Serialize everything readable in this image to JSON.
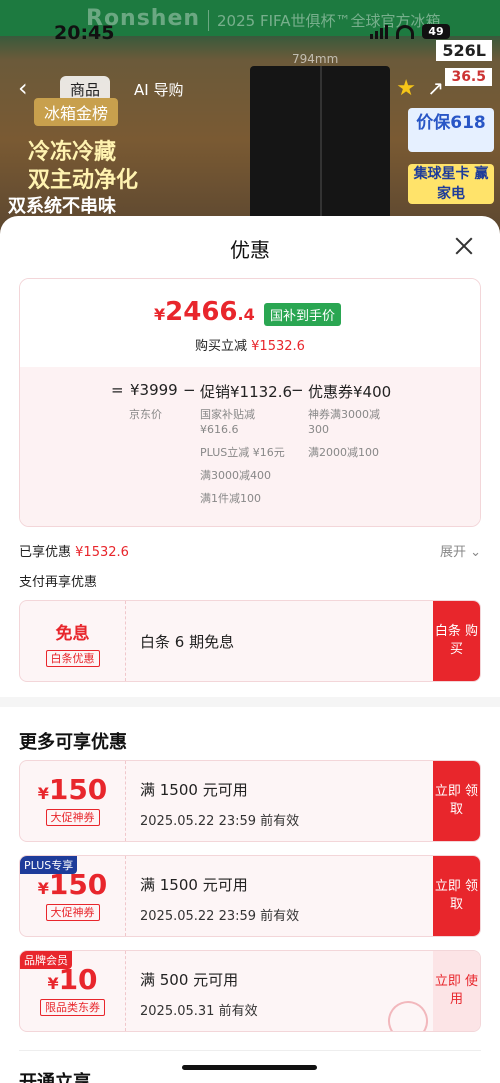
{
  "status_bar": {
    "time": "20:45",
    "battery": "49"
  },
  "background": {
    "brand": "Ronshen",
    "slogan": "2025 FIFA世俱杯™全球官方冰箱",
    "nav_tabs": [
      "商品",
      "AI 导购"
    ],
    "dimension": "794mm",
    "rank_title": "冰箱金榜",
    "slogan_lines": [
      "冷冻冷藏",
      "双主动净化",
      "双系统不串味"
    ],
    "capacity": "526L",
    "energy": "36.5",
    "promo": "价保618",
    "promo2": "集球星卡 赢家电"
  },
  "sheet": {
    "title": "优惠",
    "price": {
      "currency": "¥",
      "integer": "2466",
      "decimal": ".4",
      "tag": "国补到手价",
      "save_label": "购买立减",
      "save_value": "¥1532.6"
    },
    "formula": {
      "eq": "=",
      "base": "¥3999",
      "minus1": "−",
      "promo": "促销¥1132.6",
      "minus2": "−",
      "coupon": "优惠券¥400",
      "base_label": "京东价",
      "promo_details": [
        "国家补贴减 ¥616.6",
        "PLUS立减 ¥16元",
        "满3000减400",
        "满1件减100"
      ],
      "coupon_details": [
        "神券满3000减 300",
        "满2000减100"
      ]
    },
    "enjoyed": {
      "label": "已享优惠",
      "value": "¥1532.6",
      "expand": "展开"
    },
    "pay_title": "支付再享优惠",
    "pay_coupon": {
      "title": "免息",
      "tag": "白条优惠",
      "desc": "白条 6 期免息",
      "button": "白条 购买"
    },
    "more_title": "更多可享优惠",
    "coupons": [
      {
        "corner": "",
        "currency": "¥",
        "amount": "150",
        "tag": "大促神券",
        "title": "满 1500 元可用",
        "validity": "2025.05.22 23:59 前有效",
        "button": "立即 领取"
      },
      {
        "corner": "PLUS专享",
        "currency": "¥",
        "amount": "150",
        "tag": "大促神券",
        "title": "满 1500 元可用",
        "validity": "2025.05.22 23:59 前有效",
        "button": "立即 领取"
      },
      {
        "corner": "品牌会员",
        "currency": "¥",
        "amount": "10",
        "tag": "限品类东券",
        "title": "满 500 元可用",
        "validity": "2025.05.31 前有效",
        "button": "立即 使用"
      }
    ],
    "open_title": "开通立享"
  },
  "colors": {
    "accent": "#e8262c",
    "green_tag": "#2aa652",
    "plus_badge": "#1e3c9a"
  }
}
